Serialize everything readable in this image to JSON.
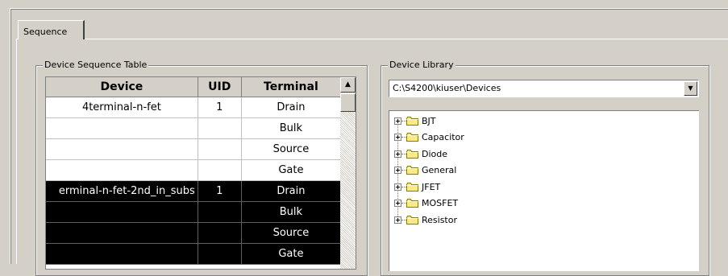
{
  "tab": {
    "label": "Sequence"
  },
  "sequence_table": {
    "group_title": "Device Sequence Table",
    "columns": [
      "Device",
      "UID",
      "Terminal"
    ],
    "rows": [
      {
        "device": "4terminal-n-fet",
        "uid": "1",
        "terminal": "Drain",
        "selected": false
      },
      {
        "device": "",
        "uid": "",
        "terminal": "Bulk",
        "selected": false
      },
      {
        "device": "",
        "uid": "",
        "terminal": "Source",
        "selected": false
      },
      {
        "device": "",
        "uid": "",
        "terminal": "Gate",
        "selected": false
      },
      {
        "device": "erminal-n-fet-2nd_in_subs",
        "uid": "1",
        "terminal": "Drain",
        "selected": true
      },
      {
        "device": "",
        "uid": "",
        "terminal": "Bulk",
        "selected": true
      },
      {
        "device": "",
        "uid": "",
        "terminal": "Source",
        "selected": true
      },
      {
        "device": "",
        "uid": "",
        "terminal": "Gate",
        "selected": true
      }
    ],
    "scroll_up_glyph": "▲"
  },
  "device_library": {
    "group_title": "Device Library",
    "path": "C:\\S4200\\kiuser\\Devices",
    "dropdown_glyph": "▼",
    "tree_items": [
      {
        "label": "BJT",
        "icon": "folder-icon"
      },
      {
        "label": "Capacitor",
        "icon": "folder-icon"
      },
      {
        "label": "Diode",
        "icon": "folder-icon"
      },
      {
        "label": "General",
        "icon": "folder-icon"
      },
      {
        "label": "JFET",
        "icon": "folder-icon"
      },
      {
        "label": "MOSFET",
        "icon": "folder-icon"
      },
      {
        "label": "Resistor",
        "icon": "folder-icon"
      }
    ]
  },
  "colors": {
    "face": "#d4d0c8",
    "selection": "#000000",
    "folder": "#ffe78c"
  }
}
